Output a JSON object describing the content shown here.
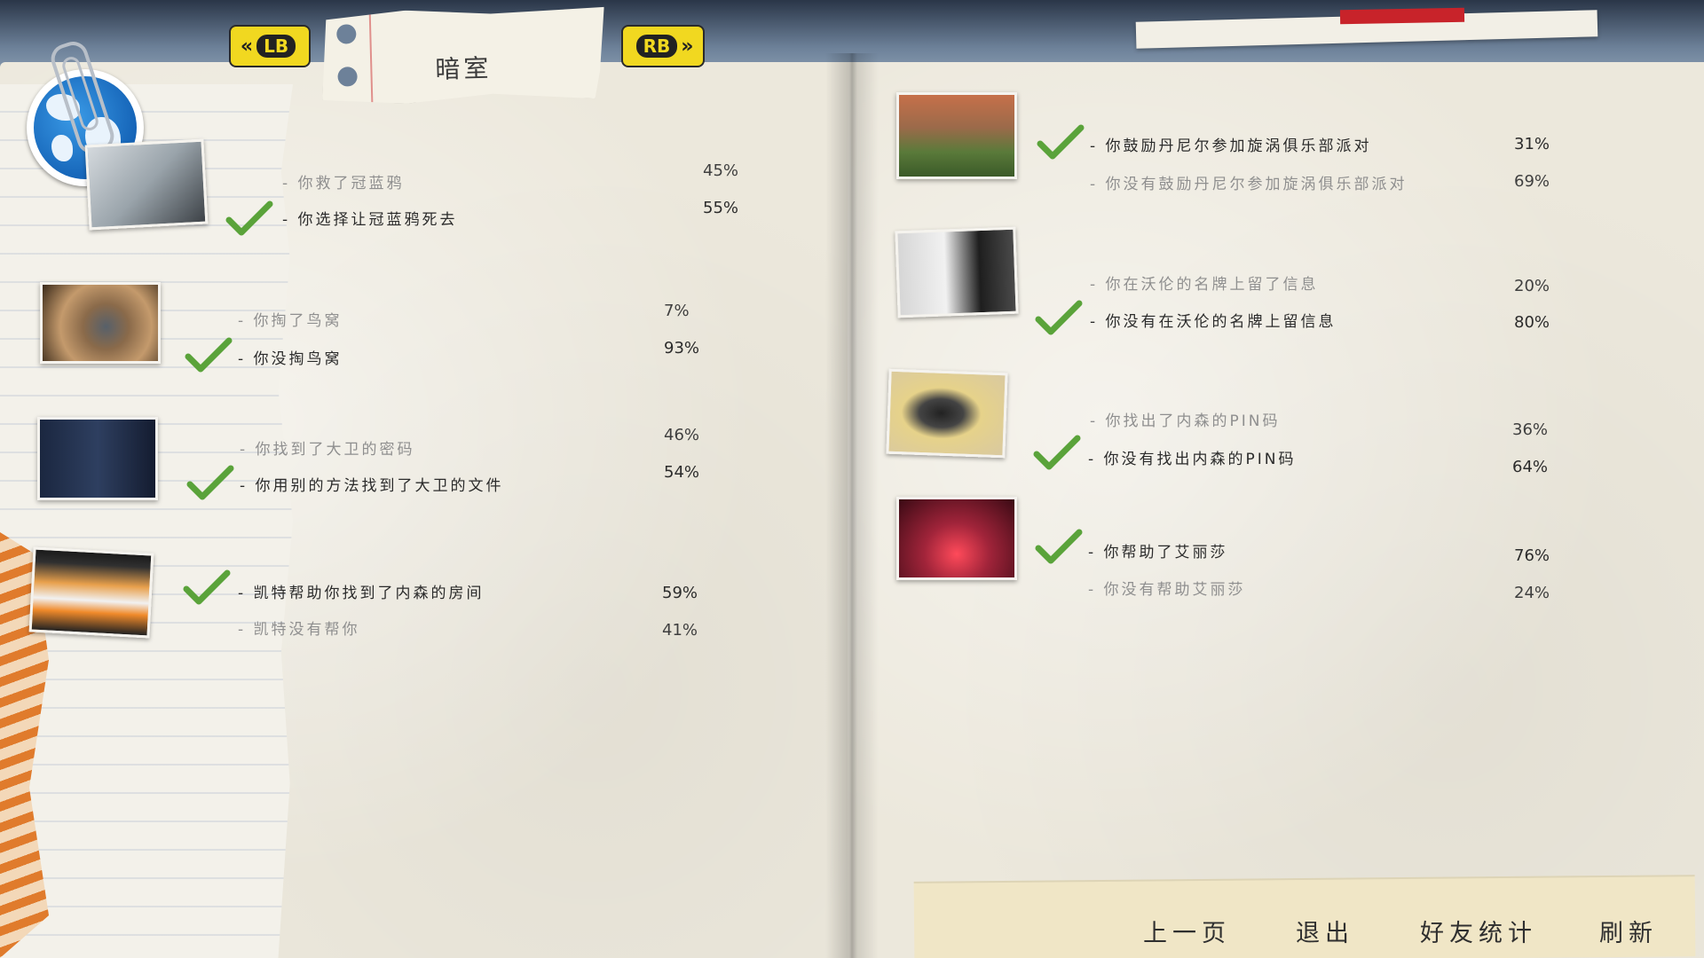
{
  "header": {
    "title": "暗室",
    "lb_label": "LB",
    "rb_label": "RB"
  },
  "left_page": {
    "groups": [
      {
        "image": "blue-jay-photo",
        "choices": [
          {
            "text": "- 你救了冠蓝鸦",
            "percent": "45%",
            "selected": false
          },
          {
            "text": "- 你选择让冠蓝鸦死去",
            "percent": "55%",
            "selected": true
          }
        ]
      },
      {
        "image": "bird-nest-photo",
        "choices": [
          {
            "text": "- 你掏了鸟窝",
            "percent": "7%",
            "selected": false
          },
          {
            "text": "- 你没掏鸟窝",
            "percent": "93%",
            "selected": true
          }
        ]
      },
      {
        "image": "locker-photo",
        "choices": [
          {
            "text": "- 你找到了大卫的密码",
            "percent": "46%",
            "selected": false
          },
          {
            "text": "- 你用别的方法找到了大卫的文件",
            "percent": "54%",
            "selected": true
          }
        ]
      },
      {
        "image": "laptop-photo",
        "choices": [
          {
            "text": "- 凯特帮助你找到了内森的房间",
            "percent": "59%",
            "selected": true
          },
          {
            "text": "- 凯特没有帮你",
            "percent": "41%",
            "selected": false
          }
        ]
      }
    ]
  },
  "right_page": {
    "groups": [
      {
        "image": "yard-photo",
        "choices": [
          {
            "text": "- 你鼓励丹尼尔参加旋涡俱乐部派对",
            "percent": "31%",
            "selected": true
          },
          {
            "text": "- 你没有鼓励丹尼尔参加旋涡俱乐部派对",
            "percent": "69%",
            "selected": false
          }
        ]
      },
      {
        "image": "door-sign-photo",
        "choices": [
          {
            "text": "- 你在沃伦的名牌上留了信息",
            "percent": "20%",
            "selected": false
          },
          {
            "text": "- 你没有在沃伦的名牌上留信息",
            "percent": "80%",
            "selected": true
          }
        ]
      },
      {
        "image": "phone-photo",
        "choices": [
          {
            "text": "- 你找出了内森的PIN码",
            "percent": "36%",
            "selected": false
          },
          {
            "text": "- 你没有找出内森的PIN码",
            "percent": "64%",
            "selected": true
          }
        ]
      },
      {
        "image": "pool-photo",
        "choices": [
          {
            "text": "- 你帮助了艾丽莎",
            "percent": "76%",
            "selected": true
          },
          {
            "text": "- 你没有帮助艾丽莎",
            "percent": "24%",
            "selected": false
          }
        ]
      }
    ]
  },
  "footer": {
    "prev_page": "上一页",
    "exit": "退出",
    "friend_stats": "好友统计",
    "refresh": "刷新"
  },
  "colors": {
    "bumper_yellow": "#f1d820",
    "check_green": "#5aa33a",
    "globe_blue": "#1e7fd4"
  }
}
